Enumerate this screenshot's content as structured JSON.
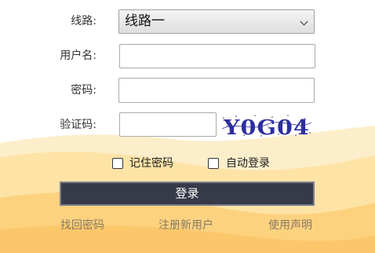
{
  "form": {
    "line_label": "线路:",
    "line_selected": "线路一",
    "username_label": "用户名:",
    "username_value": "",
    "password_label": "密码:",
    "password_value": "",
    "captcha_label": "验证码:",
    "captcha_value": "",
    "captcha_text": "Y0G04"
  },
  "options": {
    "remember_password": "记住密码",
    "auto_login": "自动登录"
  },
  "login_button": "登录",
  "links": {
    "retrieve_password": "找回密码",
    "register": "注册新用户",
    "terms": "使用声明"
  },
  "colors": {
    "button_bg": "#373a48",
    "link_text": "#8a7a62",
    "wave_light": "#fde9b8",
    "wave_mid": "#fdd98c",
    "wave_deep": "#fcc567"
  }
}
